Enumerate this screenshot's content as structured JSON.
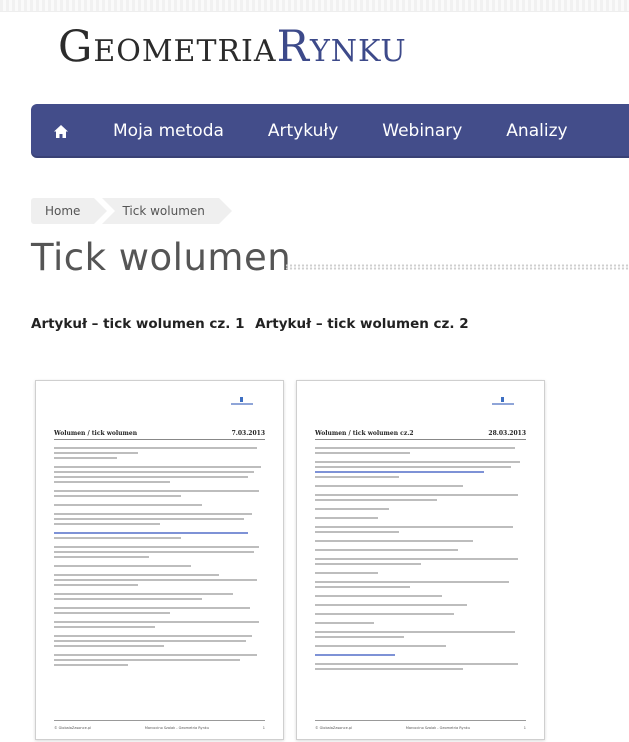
{
  "site": {
    "logo_part1": "Geometria",
    "logo_part2": "Rynku",
    "brand_color": "#434d8a",
    "logo_accent": "#3d4a8a"
  },
  "nav": {
    "home_icon": "home-icon",
    "items": [
      {
        "label": "Moja metoda"
      },
      {
        "label": "Artykuły"
      },
      {
        "label": "Webinary"
      },
      {
        "label": "Analizy"
      }
    ]
  },
  "breadcrumb": [
    {
      "label": "Home"
    },
    {
      "label": "Tick wolumen"
    }
  ],
  "page": {
    "title": "Tick wolumen"
  },
  "articles": [
    {
      "link_label": "Artykuł – tick wolumen cz. 1",
      "doc_title": "Wolumen   / tick wolumen",
      "doc_date": "7.03.2013"
    },
    {
      "link_label": "Artykuł – tick wolumen cz. 2",
      "doc_title": "Wolumen   / tick wolumen  cz.2",
      "doc_date": "28.03.2013"
    }
  ],
  "doc_footer": {
    "left": "© GlobalaZasonce.pl",
    "center": "Marcocino Szalak - Geometria Rynku",
    "right": "1"
  }
}
